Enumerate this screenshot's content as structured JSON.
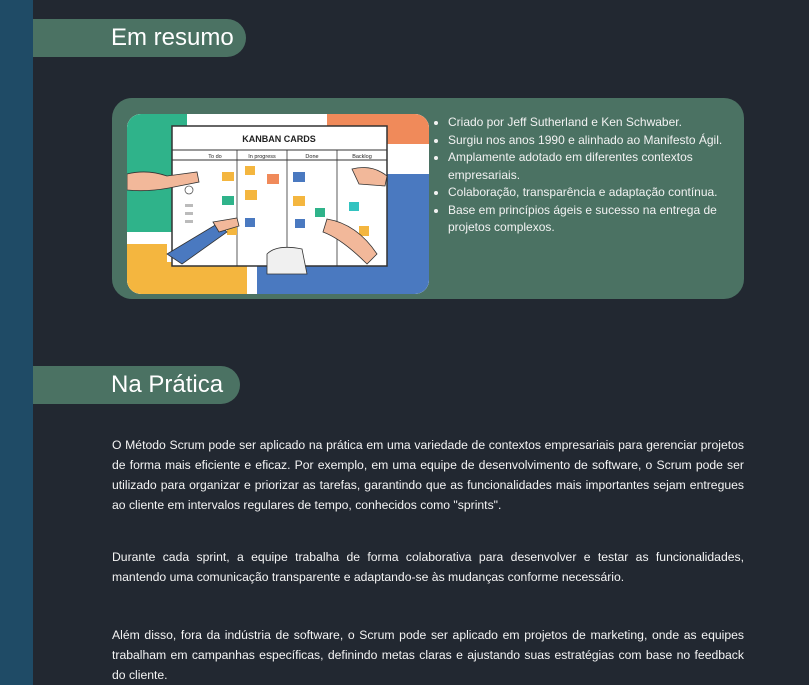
{
  "sections": {
    "summary": {
      "heading": "Em resumo",
      "image": {
        "title": "KANBAN CARDS",
        "columns": [
          "To do",
          "In progress",
          "Done",
          "Backlog"
        ]
      },
      "bullets": [
        "Criado por Jeff Sutherland e Ken Schwaber.",
        "Surgiu nos anos 1990 e alinhado ao Manifesto Ágil.",
        "Amplamente adotado em diferentes contextos empresariais.",
        "Colaboração, transparência e adaptação contínua.",
        "Base em princípios ágeis e sucesso na entrega de projetos complexos."
      ]
    },
    "practice": {
      "heading": "Na Prática",
      "paragraphs": [
        "O Método Scrum pode ser aplicado na prática em uma variedade de contextos empresariais para gerenciar projetos de forma mais eficiente e eficaz. Por exemplo, em uma equipe de desenvolvimento de software, o Scrum pode ser utilizado para organizar e priorizar as tarefas, garantindo que as funcionalidades mais importantes sejam entregues ao cliente em intervalos regulares de tempo, conhecidos como \"sprints\".",
        "Durante cada sprint, a equipe trabalha de forma colaborativa para desenvolver e testar as funcionalidades, mantendo uma comunicação transparente e adaptando-se às mudanças conforme necessário.",
        "Além disso, fora da indústria de software, o Scrum pode ser aplicado em projetos de marketing, onde as equipes trabalham em campanhas específicas, definindo metas claras e ajustando suas estratégias com base no feedback do cliente."
      ]
    }
  },
  "colors": {
    "background": "#222831",
    "stripe": "#1f4b66",
    "accent": "#4b7263",
    "text": "#f4f4f4"
  }
}
